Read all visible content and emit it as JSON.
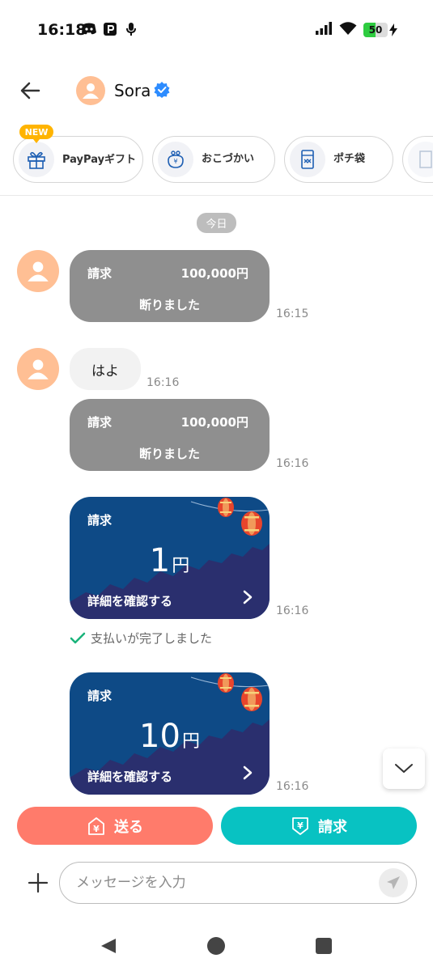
{
  "status_bar": {
    "time": "16:18",
    "battery": "50",
    "battery_level": 0.5
  },
  "header": {
    "name": "Sora"
  },
  "shortcuts": {
    "new_badge": "NEW",
    "items": [
      {
        "label": "PayPayギフト",
        "icon": "gift-icon"
      },
      {
        "label": "おこづかい",
        "icon": "coin-purse-icon"
      },
      {
        "label": "ポチ袋",
        "icon": "envelope-icon"
      }
    ]
  },
  "date_pill": "今日",
  "messages": {
    "m1": {
      "label": "請求",
      "amount": "100,000円",
      "status": "断りました",
      "time": "16:15"
    },
    "m2": {
      "text": "はよ",
      "time": "16:16"
    },
    "m3": {
      "label": "請求",
      "amount": "100,000円",
      "status": "断りました",
      "time": "16:16"
    },
    "m4": {
      "label": "請求",
      "amount": "1",
      "unit": "円",
      "detail": "詳細を確認する",
      "time": "16:16"
    },
    "m4_paid": "支払いが完了しました",
    "m5": {
      "label": "請求",
      "amount": "10",
      "unit": "円",
      "detail": "詳細を確認する",
      "time": "16:16"
    }
  },
  "actions": {
    "send": "送る",
    "request": "請求"
  },
  "composer": {
    "placeholder": "メッセージを入力"
  },
  "colors": {
    "send_button": "#ff7b6b",
    "request_button": "#08c2c2",
    "declined_bubble": "#8f8f8f",
    "request_card": "#0e4a86",
    "avatar": "#ffbf94",
    "verified": "#2d8cff"
  }
}
